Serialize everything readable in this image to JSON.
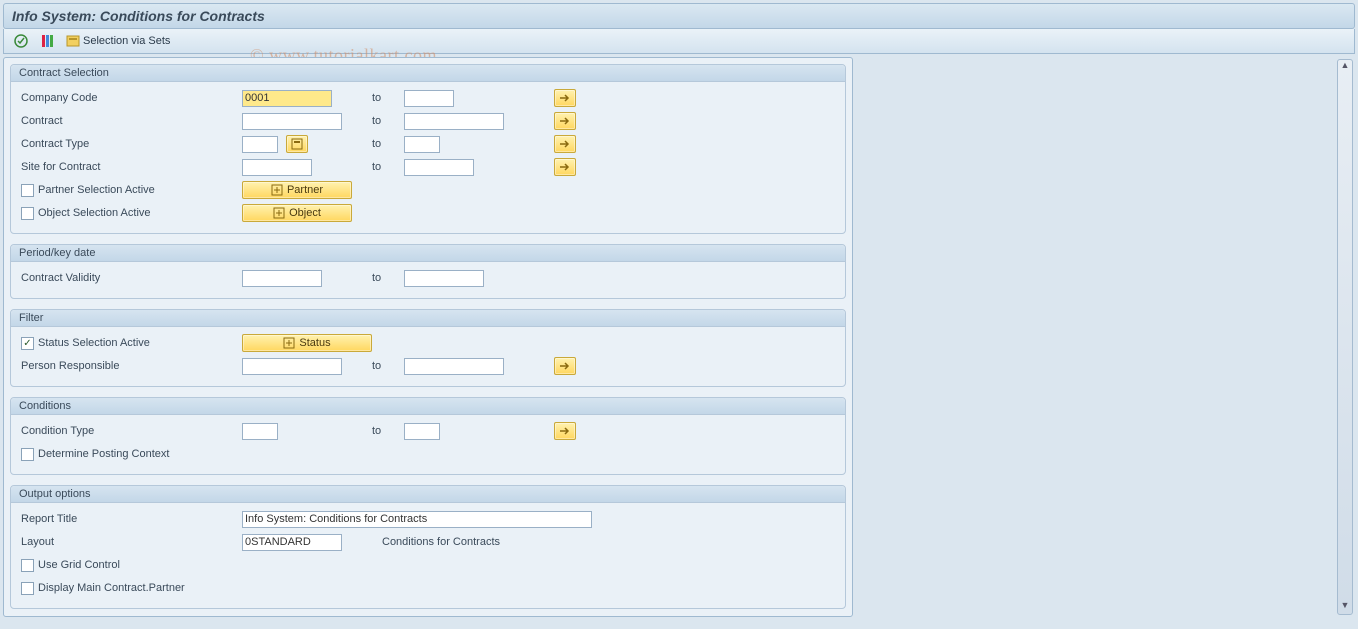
{
  "title": "Info System: Conditions for Contracts",
  "toolbar": {
    "execute_icon": "execute",
    "variants_icon": "variants",
    "selection_icon": "selection-sets",
    "selection_label": "Selection via Sets"
  },
  "watermark": "© www.tutorialkart.com",
  "groups": {
    "contract_selection": {
      "title": "Contract Selection",
      "company_code": {
        "label": "Company Code",
        "from": "0001",
        "to": ""
      },
      "contract": {
        "label": "Contract",
        "from": "",
        "to": ""
      },
      "contract_type": {
        "label": "Contract Type",
        "from": "",
        "to": ""
      },
      "site": {
        "label": "Site for Contract",
        "from": "",
        "to": ""
      },
      "partner_sel": {
        "label": "Partner Selection Active",
        "checked": false,
        "btn": "Partner"
      },
      "object_sel": {
        "label": "Object Selection Active",
        "checked": false,
        "btn": "Object"
      }
    },
    "period": {
      "title": "Period/key date",
      "validity": {
        "label": "Contract Validity",
        "from": "",
        "to": ""
      }
    },
    "filter": {
      "title": "Filter",
      "status_sel": {
        "label": "Status Selection Active",
        "checked": true,
        "btn": "Status"
      },
      "person": {
        "label": "Person Responsible",
        "from": "",
        "to": ""
      }
    },
    "conditions": {
      "title": "Conditions",
      "cond_type": {
        "label": "Condition Type",
        "from": "",
        "to": ""
      },
      "posting": {
        "label": "Determine Posting Context",
        "checked": false
      }
    },
    "output": {
      "title": "Output options",
      "report_title": {
        "label": "Report Title",
        "value": "Info System: Conditions for Contracts"
      },
      "layout": {
        "label": "Layout",
        "value": "0STANDARD",
        "desc": "Conditions for Contracts"
      },
      "grid": {
        "label": "Use Grid Control",
        "checked": false
      },
      "main_partner": {
        "label": "Display Main Contract.Partner",
        "checked": false
      }
    }
  },
  "range_to_label": "to"
}
